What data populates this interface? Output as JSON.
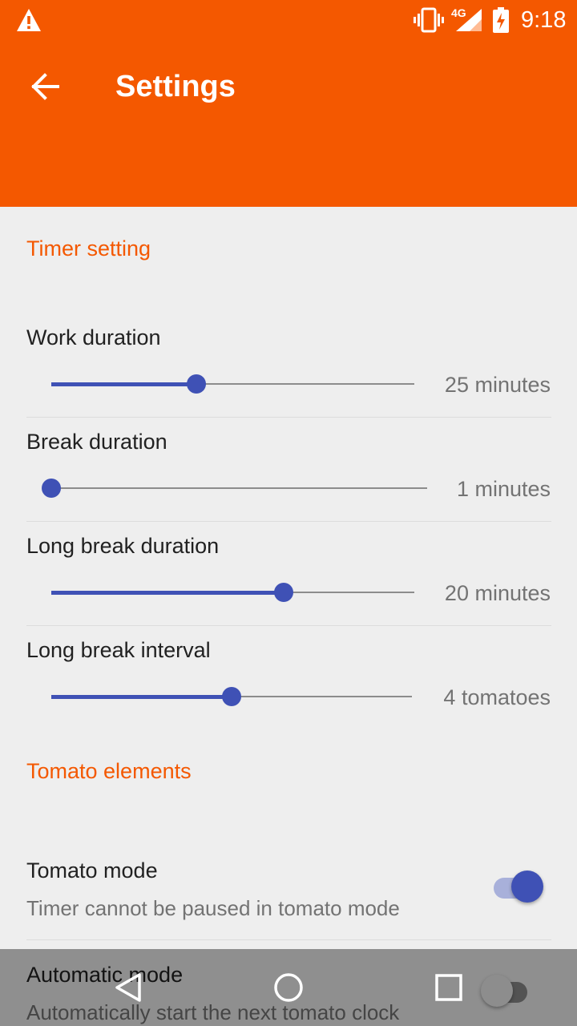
{
  "status_bar": {
    "time": "9:18",
    "network_label": "4G",
    "icons": [
      "warning-icon",
      "vibrate-icon",
      "signal-icon",
      "battery-charging-icon"
    ]
  },
  "app_bar": {
    "title": "Settings",
    "back_icon": "arrow-back-icon",
    "background": "#f45800"
  },
  "sections": {
    "timer_setting": {
      "header": "Timer setting",
      "items": [
        {
          "title": "Work duration",
          "value_label": "25 minutes",
          "progress": 0.4
        },
        {
          "title": "Break duration",
          "value_label": "1 minutes",
          "progress": 0.0
        },
        {
          "title": "Long break duration",
          "value_label": "20 minutes",
          "progress": 0.64
        },
        {
          "title": "Long break interval",
          "value_label": "4 tomatoes",
          "progress": 0.5
        }
      ]
    },
    "tomato_elements": {
      "header": "Tomato elements",
      "items": [
        {
          "title": "Tomato mode",
          "summary": "Timer cannot be paused in tomato mode",
          "enabled": true
        },
        {
          "title": "Automatic mode",
          "summary": "Automatically start the next tomato clock",
          "enabled": false
        }
      ]
    }
  },
  "nav_bar": {
    "icons": [
      "nav-back-icon",
      "nav-home-icon",
      "nav-recents-icon"
    ]
  },
  "colors": {
    "accent": "#f45800",
    "control": "#3f51b5"
  }
}
